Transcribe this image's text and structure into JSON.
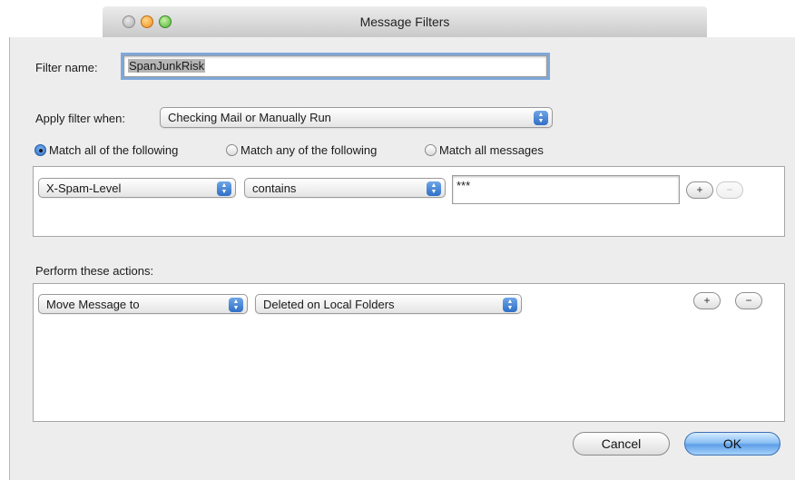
{
  "window": {
    "title": "Message Filters"
  },
  "filter_name": {
    "label": "Filter name:",
    "value": "SpanJunkRisk"
  },
  "apply_filter": {
    "label": "Apply filter when:",
    "value": "Checking Mail or Manually Run"
  },
  "match": {
    "options": [
      "Match all of the following",
      "Match any of the following",
      "Match all messages"
    ],
    "selected": "Match all of the following"
  },
  "rules": [
    {
      "field": "X-Spam-Level",
      "operator": "contains",
      "value": "***",
      "add": "+",
      "remove": "−"
    }
  ],
  "actions_section": {
    "label": "Perform these actions:"
  },
  "actions": [
    {
      "action": "Move Message to",
      "target": "Deleted on Local Folders",
      "add": "+",
      "remove": "−"
    }
  ],
  "buttons": {
    "cancel": "Cancel",
    "ok": "OK"
  },
  "colors": {
    "accent": "#2f6fc8",
    "focus_ring": "#7fa7d9",
    "window_bg": "#ededed"
  }
}
